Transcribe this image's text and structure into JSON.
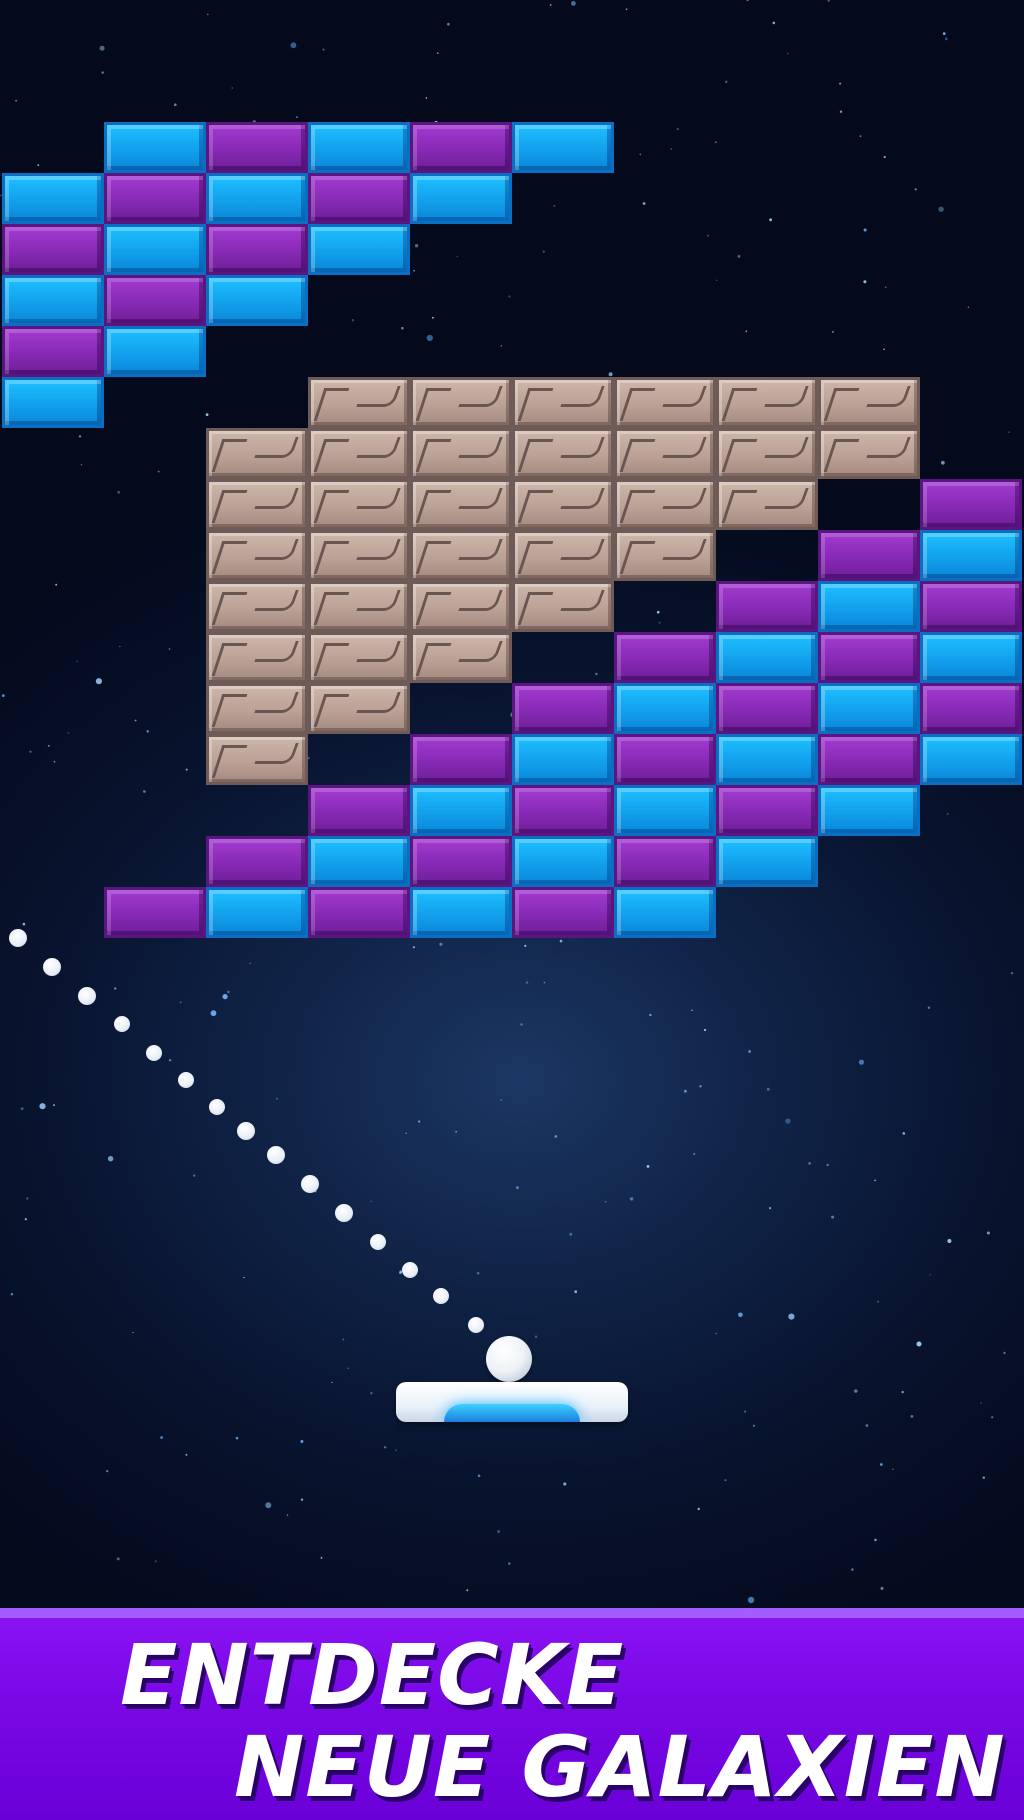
{
  "banner": {
    "line1": "ENTDECKE",
    "line2": "NEUE GALAXIEN"
  },
  "game": {
    "brick_colors": {
      "blue": "#14a6f0",
      "purple": "#8a2bb8",
      "stone": "#bba196"
    },
    "paddle_accent": "#3fd1ff",
    "background": "#0f2245",
    "banner_color": "#7a08e6"
  }
}
